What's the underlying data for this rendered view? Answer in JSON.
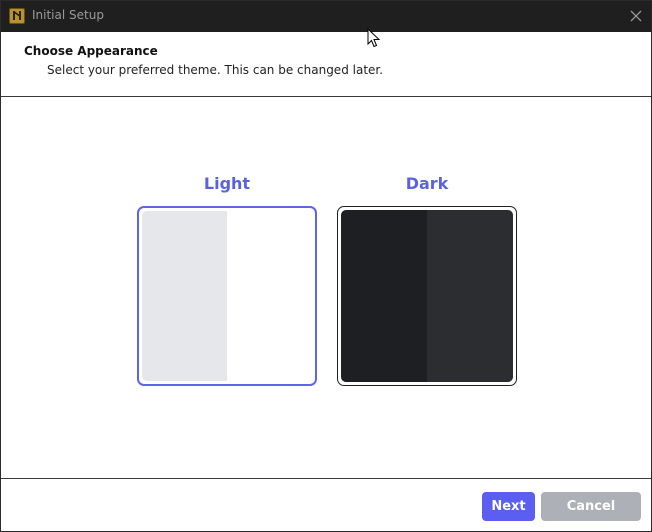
{
  "window": {
    "title": "Initial Setup",
    "app_icon": "app-logo-icon",
    "close_icon": "close-icon"
  },
  "header": {
    "title": "Choose Appearance",
    "subtitle": "Select your preferred theme. This can be changed later."
  },
  "themes": [
    {
      "label": "Light",
      "selected": true,
      "colors": {
        "left": "#e6e7ea",
        "right": "#ffffff"
      }
    },
    {
      "label": "Dark",
      "selected": false,
      "colors": {
        "left": "#1e1f22",
        "right": "#2b2d31"
      }
    }
  ],
  "footer": {
    "next_label": "Next",
    "cancel_label": "Cancel"
  },
  "colors": {
    "accent": "#5b5ef0",
    "label_accent": "#5a62e0",
    "titlebar": "#1f1f1f",
    "cancel_bg": "#aeb0b7"
  }
}
